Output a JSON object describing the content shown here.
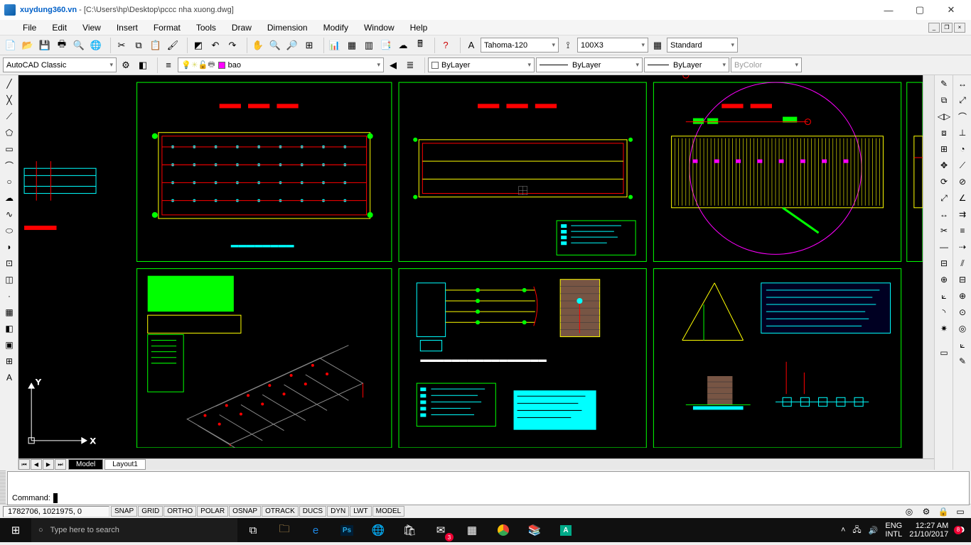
{
  "titlebar": {
    "app": "xuydung360.vn",
    "doc": " - [C:\\Users\\hp\\Desktop\\pccc nha xuong.dwg]"
  },
  "menu": [
    "File",
    "Edit",
    "View",
    "Insert",
    "Format",
    "Tools",
    "Draw",
    "Dimension",
    "Modify",
    "Window",
    "Help"
  ],
  "toolbar1": {
    "textstyle": "Tahoma-120",
    "dimstyle": "100X3",
    "tablestyle": "Standard"
  },
  "toolbar2": {
    "workspace": "AutoCAD Classic",
    "layer": "bao",
    "linetype": "ByLayer",
    "lineweight": "ByLayer",
    "plotstyle": "ByLayer",
    "color": "ByColor"
  },
  "tabs": {
    "model": "Model",
    "layout1": "Layout1"
  },
  "command": {
    "prompt": "Command:"
  },
  "status": {
    "coords": "1782706, 1021975, 0",
    "toggles": [
      "SNAP",
      "GRID",
      "ORTHO",
      "POLAR",
      "OSNAP",
      "OTRACK",
      "DUCS",
      "DYN",
      "LWT",
      "MODEL"
    ]
  },
  "taskbar": {
    "search": "Type here to search",
    "lang1": "ENG",
    "lang2": "INTL",
    "time": "12:27 AM",
    "date": "21/10/2017",
    "notif": "8",
    "mail_badge": "3"
  }
}
